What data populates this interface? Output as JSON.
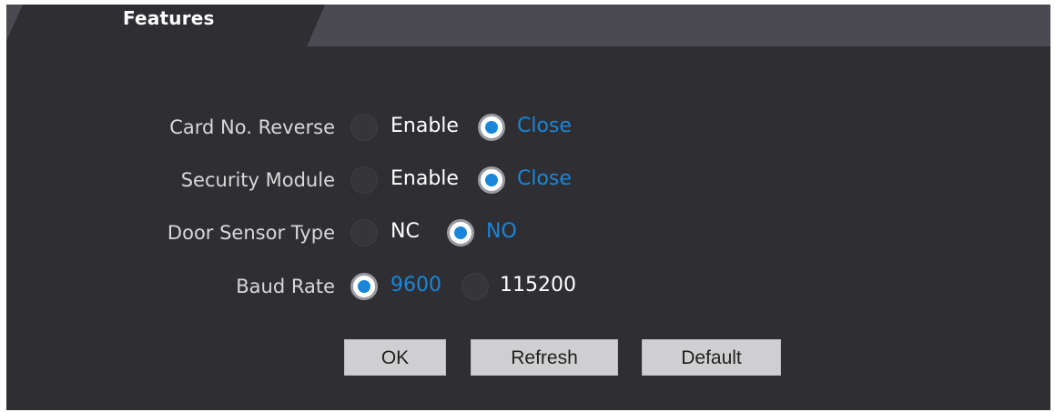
{
  "tab": {
    "title": "Features"
  },
  "colors": {
    "panel": "#2f2f33",
    "tab_active": "#2f2f33",
    "tab_inactive": "#4a4a50",
    "accent": "#1a86d9"
  },
  "settings": [
    {
      "label": "Card No. Reverse",
      "options": [
        {
          "label": "Enable",
          "selected": false
        },
        {
          "label": "Close",
          "selected": true
        }
      ]
    },
    {
      "label": "Security Module",
      "options": [
        {
          "label": "Enable",
          "selected": false
        },
        {
          "label": "Close",
          "selected": true
        }
      ]
    },
    {
      "label": "Door Sensor Type",
      "options": [
        {
          "label": "NC",
          "selected": false
        },
        {
          "label": "NO",
          "selected": true
        }
      ]
    },
    {
      "label": "Baud Rate",
      "options": [
        {
          "label": "9600",
          "selected": true
        },
        {
          "label": "115200",
          "selected": false
        }
      ]
    }
  ],
  "buttons": {
    "ok": "OK",
    "refresh": "Refresh",
    "default": "Default"
  }
}
